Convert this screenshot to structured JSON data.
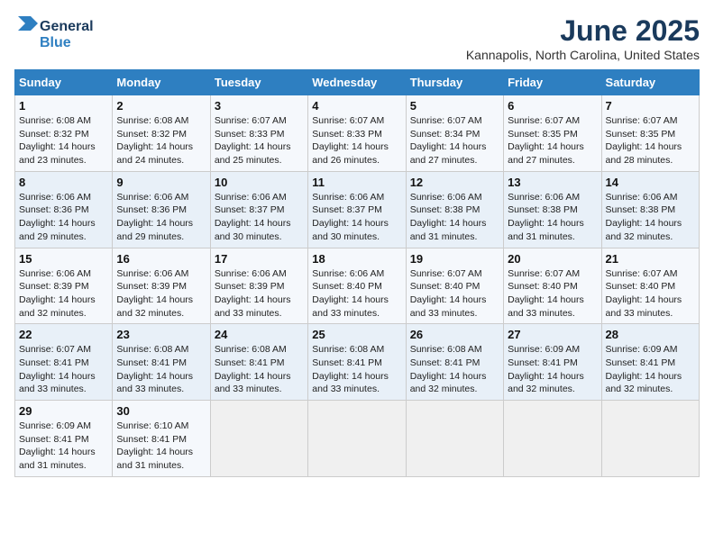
{
  "header": {
    "logo_general": "General",
    "logo_blue": "Blue",
    "title": "June 2025",
    "subtitle": "Kannapolis, North Carolina, United States"
  },
  "weekdays": [
    "Sunday",
    "Monday",
    "Tuesday",
    "Wednesday",
    "Thursday",
    "Friday",
    "Saturday"
  ],
  "weeks": [
    [
      {
        "day": "1",
        "info": "Sunrise: 6:08 AM\nSunset: 8:32 PM\nDaylight: 14 hours\nand 23 minutes."
      },
      {
        "day": "2",
        "info": "Sunrise: 6:08 AM\nSunset: 8:32 PM\nDaylight: 14 hours\nand 24 minutes."
      },
      {
        "day": "3",
        "info": "Sunrise: 6:07 AM\nSunset: 8:33 PM\nDaylight: 14 hours\nand 25 minutes."
      },
      {
        "day": "4",
        "info": "Sunrise: 6:07 AM\nSunset: 8:33 PM\nDaylight: 14 hours\nand 26 minutes."
      },
      {
        "day": "5",
        "info": "Sunrise: 6:07 AM\nSunset: 8:34 PM\nDaylight: 14 hours\nand 27 minutes."
      },
      {
        "day": "6",
        "info": "Sunrise: 6:07 AM\nSunset: 8:35 PM\nDaylight: 14 hours\nand 27 minutes."
      },
      {
        "day": "7",
        "info": "Sunrise: 6:07 AM\nSunset: 8:35 PM\nDaylight: 14 hours\nand 28 minutes."
      }
    ],
    [
      {
        "day": "8",
        "info": "Sunrise: 6:06 AM\nSunset: 8:36 PM\nDaylight: 14 hours\nand 29 minutes."
      },
      {
        "day": "9",
        "info": "Sunrise: 6:06 AM\nSunset: 8:36 PM\nDaylight: 14 hours\nand 29 minutes."
      },
      {
        "day": "10",
        "info": "Sunrise: 6:06 AM\nSunset: 8:37 PM\nDaylight: 14 hours\nand 30 minutes."
      },
      {
        "day": "11",
        "info": "Sunrise: 6:06 AM\nSunset: 8:37 PM\nDaylight: 14 hours\nand 30 minutes."
      },
      {
        "day": "12",
        "info": "Sunrise: 6:06 AM\nSunset: 8:38 PM\nDaylight: 14 hours\nand 31 minutes."
      },
      {
        "day": "13",
        "info": "Sunrise: 6:06 AM\nSunset: 8:38 PM\nDaylight: 14 hours\nand 31 minutes."
      },
      {
        "day": "14",
        "info": "Sunrise: 6:06 AM\nSunset: 8:38 PM\nDaylight: 14 hours\nand 32 minutes."
      }
    ],
    [
      {
        "day": "15",
        "info": "Sunrise: 6:06 AM\nSunset: 8:39 PM\nDaylight: 14 hours\nand 32 minutes."
      },
      {
        "day": "16",
        "info": "Sunrise: 6:06 AM\nSunset: 8:39 PM\nDaylight: 14 hours\nand 32 minutes."
      },
      {
        "day": "17",
        "info": "Sunrise: 6:06 AM\nSunset: 8:39 PM\nDaylight: 14 hours\nand 33 minutes."
      },
      {
        "day": "18",
        "info": "Sunrise: 6:06 AM\nSunset: 8:40 PM\nDaylight: 14 hours\nand 33 minutes."
      },
      {
        "day": "19",
        "info": "Sunrise: 6:07 AM\nSunset: 8:40 PM\nDaylight: 14 hours\nand 33 minutes."
      },
      {
        "day": "20",
        "info": "Sunrise: 6:07 AM\nSunset: 8:40 PM\nDaylight: 14 hours\nand 33 minutes."
      },
      {
        "day": "21",
        "info": "Sunrise: 6:07 AM\nSunset: 8:40 PM\nDaylight: 14 hours\nand 33 minutes."
      }
    ],
    [
      {
        "day": "22",
        "info": "Sunrise: 6:07 AM\nSunset: 8:41 PM\nDaylight: 14 hours\nand 33 minutes."
      },
      {
        "day": "23",
        "info": "Sunrise: 6:08 AM\nSunset: 8:41 PM\nDaylight: 14 hours\nand 33 minutes."
      },
      {
        "day": "24",
        "info": "Sunrise: 6:08 AM\nSunset: 8:41 PM\nDaylight: 14 hours\nand 33 minutes."
      },
      {
        "day": "25",
        "info": "Sunrise: 6:08 AM\nSunset: 8:41 PM\nDaylight: 14 hours\nand 33 minutes."
      },
      {
        "day": "26",
        "info": "Sunrise: 6:08 AM\nSunset: 8:41 PM\nDaylight: 14 hours\nand 32 minutes."
      },
      {
        "day": "27",
        "info": "Sunrise: 6:09 AM\nSunset: 8:41 PM\nDaylight: 14 hours\nand 32 minutes."
      },
      {
        "day": "28",
        "info": "Sunrise: 6:09 AM\nSunset: 8:41 PM\nDaylight: 14 hours\nand 32 minutes."
      }
    ],
    [
      {
        "day": "29",
        "info": "Sunrise: 6:09 AM\nSunset: 8:41 PM\nDaylight: 14 hours\nand 31 minutes."
      },
      {
        "day": "30",
        "info": "Sunrise: 6:10 AM\nSunset: 8:41 PM\nDaylight: 14 hours\nand 31 minutes."
      },
      {
        "day": "",
        "info": ""
      },
      {
        "day": "",
        "info": ""
      },
      {
        "day": "",
        "info": ""
      },
      {
        "day": "",
        "info": ""
      },
      {
        "day": "",
        "info": ""
      }
    ]
  ]
}
